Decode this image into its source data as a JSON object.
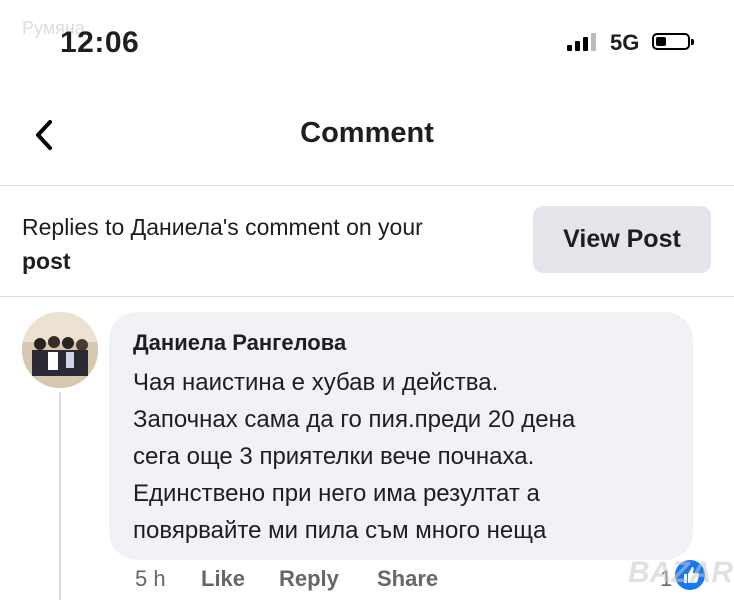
{
  "watermark_top": "Румяна",
  "watermark_bottom": "BAZAR",
  "status_bar": {
    "time": "12:06",
    "network": "5G"
  },
  "nav": {
    "title": "Comment"
  },
  "reply_banner": {
    "text": "Replies to Даниела's comment on your",
    "text_bold": "post",
    "view_post_label": "View Post"
  },
  "comment": {
    "author": "Даниела Рангелова",
    "lines": [
      "Чая наистина е хубав и действа.",
      "Започнах сама да го пия.преди 20 дена",
      "сега още 3 приятелки вече почнаха.",
      "Единствено при него има резултат а",
      "повярвайте ми пила съм много неща"
    ],
    "time_ago": "5 h",
    "like_label": "Like",
    "reply_label": "Reply",
    "share_label": "Share",
    "like_count": "1"
  },
  "colors": {
    "bubble": "#f0f2f5",
    "button": "#e4e6eb",
    "meta_text": "#65676b",
    "like_blue": "#1877f2"
  },
  "icons": {
    "back": "chevron-left-icon",
    "like": "thumbs-up-icon"
  }
}
